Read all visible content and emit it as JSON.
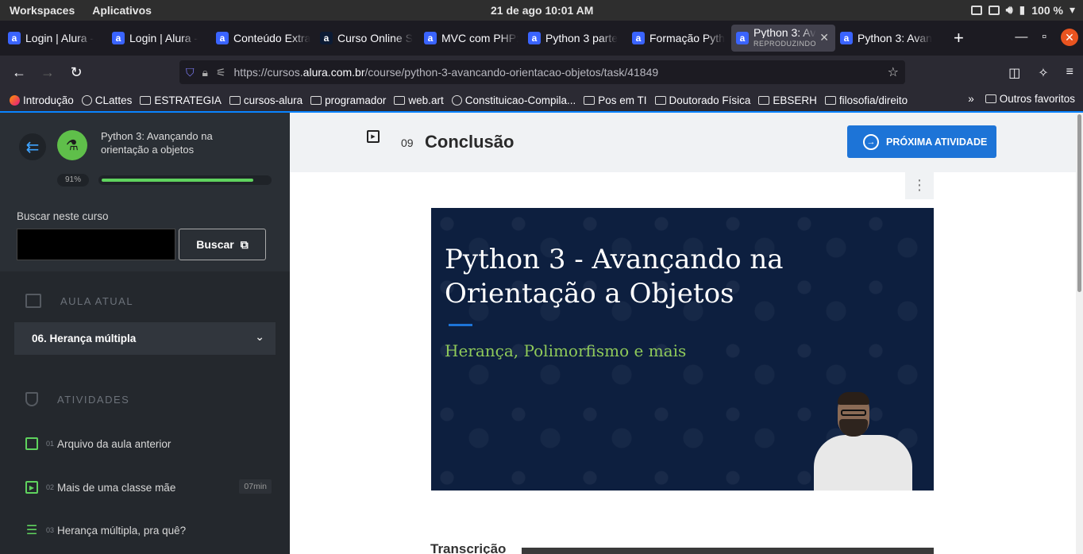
{
  "system_bar": {
    "workspaces": "Workspaces",
    "apps": "Aplicativos",
    "clock": "21 de ago  10:01 AM",
    "battery": "100 %"
  },
  "tabs": [
    {
      "label": "Login | Alura -",
      "favicon": "alura-icon"
    },
    {
      "label": "Login | Alura -",
      "favicon": "alura-icon"
    },
    {
      "label": "Conteúdo Extra",
      "favicon": "alura-icon"
    },
    {
      "label": "Curso Online S",
      "favicon": "alura-dark-icon"
    },
    {
      "label": "MVC com PHP:",
      "favicon": "alura-icon"
    },
    {
      "label": "Python 3 parte",
      "favicon": "alura-icon"
    },
    {
      "label": "Formação Pyth",
      "favicon": "alura-icon"
    },
    {
      "label": "Python 3: Av",
      "sub": "REPRODUZINDO",
      "favicon": "alura-icon",
      "active": true
    },
    {
      "label": "Python 3: Avan",
      "favicon": "alura-icon"
    }
  ],
  "url": {
    "prefix": "https://cursos.",
    "domain": "alura.com.br",
    "path": "/course/python-3-avancando-orientacao-objetos/task/41849"
  },
  "bookmarks": [
    {
      "label": "Introdução",
      "icon": "firefox-icon"
    },
    {
      "label": "CLattes",
      "icon": "globe-icon"
    },
    {
      "label": "ESTRATEGIA",
      "icon": "folder-icon"
    },
    {
      "label": "cursos-alura",
      "icon": "folder-icon"
    },
    {
      "label": "programador",
      "icon": "folder-icon"
    },
    {
      "label": "web.art",
      "icon": "folder-icon"
    },
    {
      "label": "Constituicao-Compila...",
      "icon": "globe-icon"
    },
    {
      "label": "Pos em TI",
      "icon": "folder-icon"
    },
    {
      "label": "Doutorado Física",
      "icon": "folder-icon"
    },
    {
      "label": "EBSERH",
      "icon": "folder-icon"
    },
    {
      "label": "filosofia/direito",
      "icon": "folder-icon"
    }
  ],
  "bookmarks_other": "Outros favoritos",
  "sidebar": {
    "course_title": "Python 3: Avançando na orientação a objetos",
    "progress_label": "91%",
    "progress": 0.91,
    "search_label": "Buscar neste curso",
    "search_button": "Buscar",
    "current_lesson_heading": "AULA ATUAL",
    "current_lesson": "06. Herança múltipla",
    "activities_heading": "ATIVIDADES",
    "activities": [
      {
        "num": "01",
        "label": "Arquivo da aula anterior",
        "icon": "book-icon",
        "duration": ""
      },
      {
        "num": "02",
        "label": "Mais de uma classe mãe",
        "icon": "video-icon",
        "duration": "07min"
      },
      {
        "num": "03",
        "label": "Herança múltipla, pra quê?",
        "icon": "list-icon",
        "duration": ""
      }
    ]
  },
  "main": {
    "task_number": "09",
    "task_title": "Conclusão",
    "next_button": "PRÓXIMA ATIVIDADE",
    "video_title": "Python 3 - Avançando na Orientação a Objetos",
    "video_subtitle": "Herança, Polimorfismo e mais",
    "transcription_heading": "Transcrição"
  },
  "colors": {
    "accent": "#1d74d7",
    "progress": "#5fd35e",
    "video_bg": "#0d1f3f",
    "subtitle": "#8fca5a"
  }
}
